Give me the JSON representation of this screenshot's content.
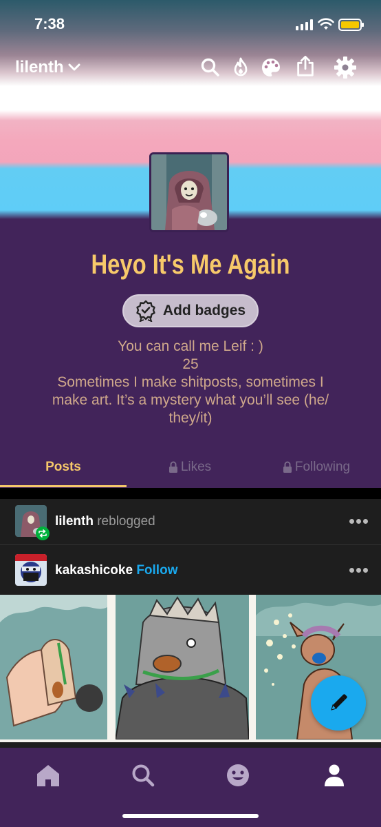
{
  "status_bar": {
    "time": "7:38"
  },
  "header": {
    "blog_name": "lilenth"
  },
  "profile": {
    "title": "Heyo It's Me Again",
    "badges_label": "Add badges",
    "bio_lines": [
      "You can call me Leif : )",
      "25",
      "Sometimes I make shitposts, sometimes I",
      "make art. It’s a mystery what you’ll see (he/",
      "they/it)"
    ]
  },
  "tabs": [
    {
      "label": "Posts",
      "active": true,
      "locked": false
    },
    {
      "label": "Likes",
      "active": false,
      "locked": true
    },
    {
      "label": "Following",
      "active": false,
      "locked": true
    }
  ],
  "post": {
    "reblogger": "lilenth",
    "reblog_text": "reblogged",
    "author": "kakashicoke",
    "follow_label": "Follow"
  },
  "colors": {
    "accent": "#f7c96a",
    "background": "#42245a",
    "link": "#1aa9ee",
    "battery": "#f5c800"
  },
  "icons": [
    "search-icon",
    "flame-icon",
    "palette-icon",
    "share-icon",
    "gear-icon",
    "badge-icon",
    "lock-icon",
    "more-icon",
    "pencil-icon",
    "home-icon",
    "search-nav-icon",
    "emoji-icon",
    "account-icon"
  ]
}
